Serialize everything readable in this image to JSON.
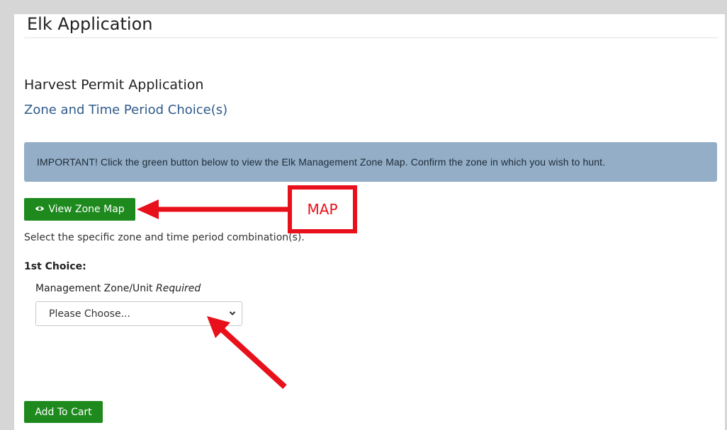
{
  "page": {
    "app_title": "Elk Application",
    "section_title": "Harvest Permit Application",
    "section_subtitle": "Zone and Time Period Choice(s)"
  },
  "alert": {
    "text": "IMPORTANT! Click the green button below to view the Elk Management Zone Map. Confirm the zone in which you wish to hunt."
  },
  "buttons": {
    "view_map_label": "View Zone Map",
    "view_map_icon": "eye-icon",
    "add_to_cart_label": "Add To Cart"
  },
  "form": {
    "help_text": "Select the specific zone and time period combination(s).",
    "choice_label": "1st Choice:",
    "field_label": "Management Zone/Unit",
    "required_text": "Required",
    "select_value": "Please Choose..."
  },
  "annotations": {
    "callout_text": "MAP",
    "color": "#e8101a"
  },
  "colors": {
    "button_green": "#1e8a1e",
    "alert_bg": "#93aec6",
    "subtitle_blue": "#2f5a8a"
  }
}
